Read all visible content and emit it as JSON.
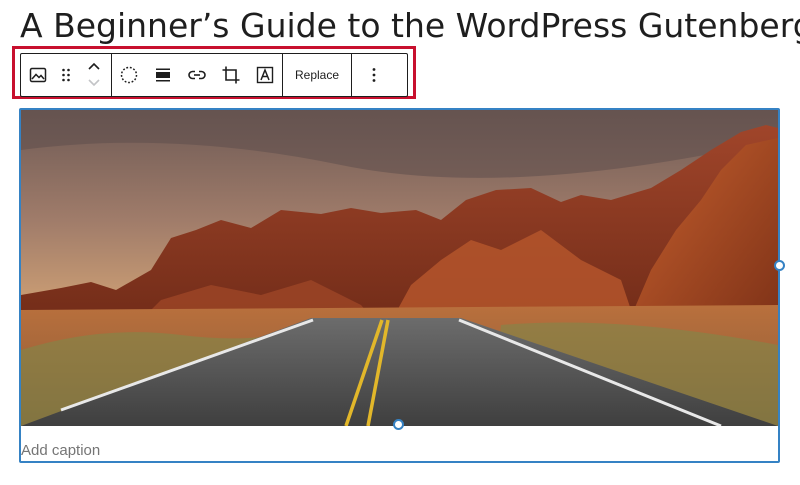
{
  "post": {
    "title": "A Beginner’s Guide to the WordPress Gutenberg"
  },
  "toolbar": {
    "block_type_icon": "image-icon",
    "drag_handle_icon": "drag-handle-icon",
    "move_up_icon": "chevron-up-icon",
    "move_down_icon": "chevron-down-icon",
    "duotone_icon": "duotone-filter-icon",
    "align_icon": "align-wide-icon",
    "link_icon": "link-icon",
    "crop_icon": "crop-icon",
    "text_overlay_icon": "text-overlay-icon",
    "replace_label": "Replace",
    "options_icon": "more-vertical-icon"
  },
  "image_block": {
    "caption_placeholder": "Add caption",
    "image_subject": "Desert road through red rock mountains at sunset"
  },
  "colors": {
    "selection_border": "#3582c4",
    "annotation_highlight": "#c8102e",
    "text": "#1e1e1e",
    "placeholder": "#757575"
  }
}
